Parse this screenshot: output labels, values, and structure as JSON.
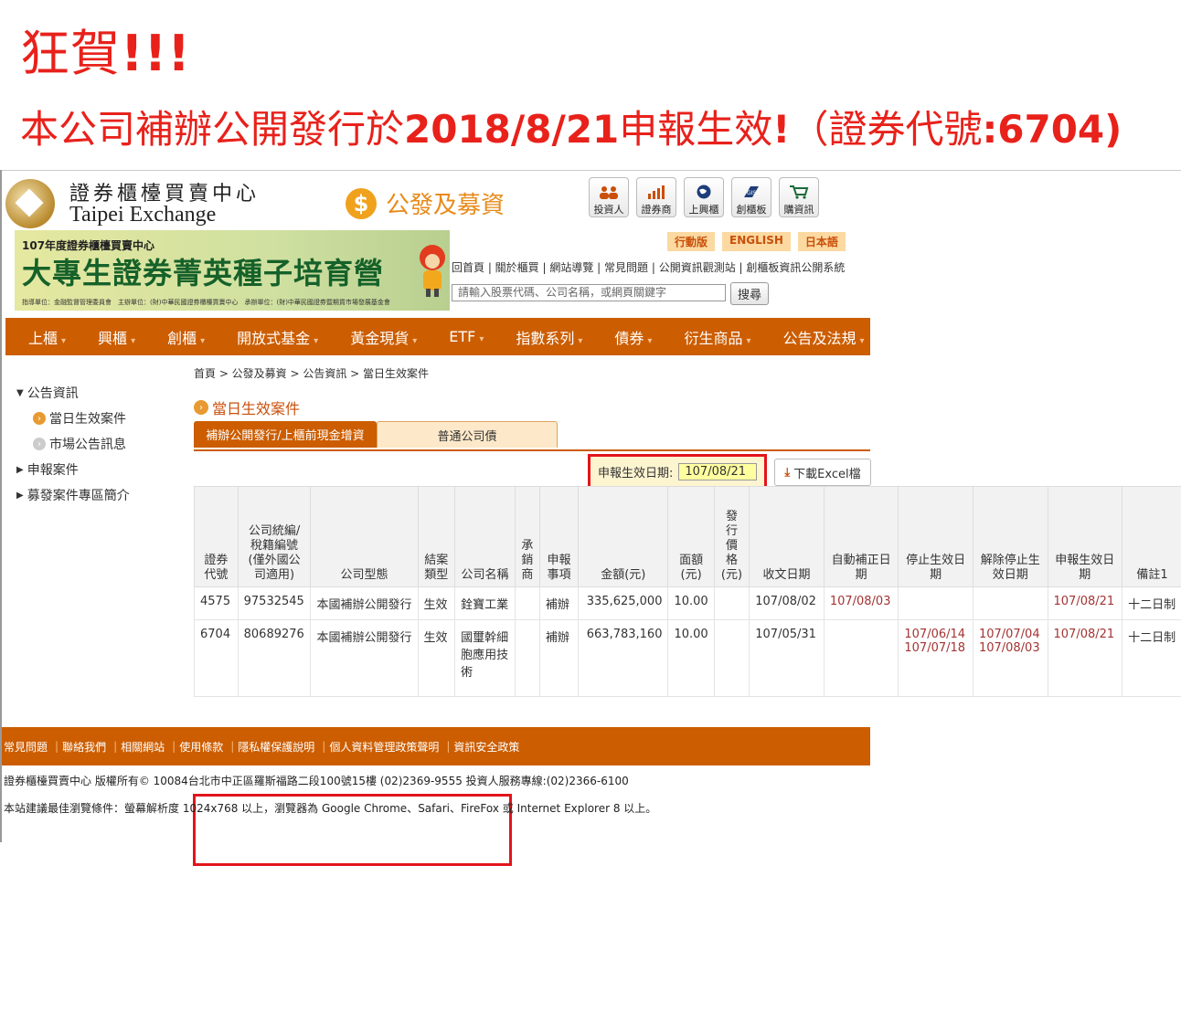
{
  "headline": {
    "line1_text": "狂賀",
    "line1_bang": "!!!",
    "line2_a": "本公司補辦公開發行於",
    "line2_b": "2018/8/21",
    "line2_c": "申報生效",
    "line2_d": "!",
    "line2_e": "（證券代號",
    "line2_f": ":6704)"
  },
  "logo": {
    "cn": "證券櫃檯買賣中心",
    "en": "Taipei Exchange"
  },
  "section": {
    "icon": "dollar-icon",
    "title": "公發及募資"
  },
  "iconbar": [
    {
      "label": "投資人",
      "icon": "investor-icon"
    },
    {
      "label": "證券商",
      "icon": "broker-chart-icon"
    },
    {
      "label": "上興櫃",
      "icon": "globe-icon"
    },
    {
      "label": "創櫃板",
      "icon": "gisa-icon"
    },
    {
      "label": "購資訊",
      "icon": "cart-icon"
    }
  ],
  "banner": {
    "small": "107年度證券櫃檯買賣中心",
    "big": "大專生證券菁英種子培育營",
    "foot": "指導單位：金融監督管理委員會　主辦單位：(財)中華民國證券櫃檯買賣中心　承辦單位：(財)中華民國證券暨期貨市場發展基金會"
  },
  "languages": [
    "行動版",
    "ENGLISH",
    "日本語"
  ],
  "toplinks": "回首頁 | 關於櫃買 | 網站導覽 | 常見問題 | 公開資訊觀測站 | 創櫃板資訊公開系統",
  "search": {
    "placeholder": "請輸入股票代碼、公司名稱，或網頁關鍵字",
    "button": "搜尋"
  },
  "nav": [
    "上櫃",
    "興櫃",
    "創櫃",
    "開放式基金",
    "黃金現貨",
    "ETF",
    "指數系列",
    "債券",
    "衍生商品",
    "公告及法規"
  ],
  "sidebar": {
    "group1": "公告資訊",
    "sub1": "當日生效案件",
    "sub2": "市場公告訊息",
    "group2": "申報案件",
    "group3": "募發案件專區簡介"
  },
  "breadcrumb": "首頁 > 公發及募資 > 公告資訊 > 當日生效案件",
  "page_title": "當日生效案件",
  "tabs": [
    "補辦公開發行/上櫃前現金增資",
    "普通公司債"
  ],
  "date_filter": {
    "label": "申報生效日期:",
    "value": "107/08/21"
  },
  "excel_button": "下載Excel檔",
  "table": {
    "headers": [
      "證券\n代號",
      "公司統編/\n稅籍編號\n(僅外國公\n司適用)",
      "公司型態",
      "結案\n類型",
      "公司名稱",
      "承\n銷\n商",
      "申報\n事項",
      "金額(元)",
      "面額\n(元)",
      "發\n行\n價\n格\n(元)",
      "收文日期",
      "自動補正日\n期",
      "停止生效日\n期",
      "解除停止生\n效日期",
      "申報生效日\n期",
      "備註1"
    ],
    "rows": [
      [
        "4575",
        "97532545",
        "本國補辦公開發行",
        "生效",
        "銓寶工業",
        "",
        "補辦",
        "335,625,000",
        "10.00",
        "",
        "107/08/02",
        "107/08/03",
        "",
        "",
        "107/08/21",
        "十二日制"
      ],
      [
        "6704",
        "80689276",
        "本國補辦公開發行",
        "生效",
        "國璽幹細\n胞應用技\n術",
        "",
        "補辦",
        "663,783,160",
        "10.00",
        "",
        "107/05/31",
        "",
        "107/06/14\n107/07/18",
        "107/07/04\n107/08/03",
        "107/08/21",
        "十二日制"
      ]
    ]
  },
  "footer": {
    "links": [
      "常見問題",
      "聯絡我們",
      "相關網站",
      "使用條款",
      "隱私權保護說明",
      "個人資料管理政策聲明",
      "資訊安全政策"
    ],
    "copyright": "證券櫃檯買賣中心 版權所有©  10084台北市中正區羅斯福路二段100號15樓 (02)2369-9555 投資人服務專線:(02)2366-6100",
    "note": "本站建議最佳瀏覽條件：螢幕解析度 1024x768 以上，瀏覽器為 Google Chrome、Safari、FireFox 或 Internet Explorer 8 以上。"
  },
  "colors": {
    "accent_red": "#e8211b",
    "nav_orange": "#cc5d00",
    "highlight_red": "#e3141c"
  }
}
